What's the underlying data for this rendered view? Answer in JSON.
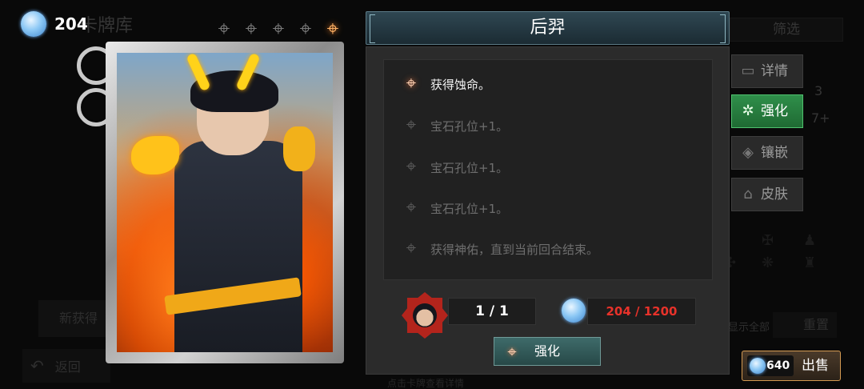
{
  "currency": {
    "gem_count": "204"
  },
  "background": {
    "title": "卡牌库",
    "filter_label": "筛选",
    "new_label": "新获得",
    "back_label": "返回",
    "show_all_label": "显示全部",
    "reset_label": "重置",
    "num_3": "3",
    "num_7": "7+",
    "bottom_hint": "点击卡牌查看详情"
  },
  "stars": {
    "total": 5,
    "active_index": 4
  },
  "card": {
    "name": "后羿"
  },
  "abilities": [
    {
      "text": "获得蚀命。",
      "active": true
    },
    {
      "text": "宝石孔位+1。",
      "active": false
    },
    {
      "text": "宝石孔位+1。",
      "active": false
    },
    {
      "text": "宝石孔位+1。",
      "active": false
    },
    {
      "text": "获得神佑，直到当前回合结束。",
      "active": false
    }
  ],
  "upgrade": {
    "level": "1 / 1",
    "cost": "204 / 1200",
    "cost_color": "#e8322a",
    "button_label": "强化"
  },
  "side_menu": [
    {
      "label": "详情",
      "icon": "card-icon",
      "active": false
    },
    {
      "label": "强化",
      "icon": "sparkle-icon",
      "active": true
    },
    {
      "label": "镶嵌",
      "icon": "gem-socket-icon",
      "active": false
    },
    {
      "label": "皮肤",
      "icon": "hanger-icon",
      "active": false
    }
  ],
  "sell": {
    "price": "640",
    "label": "出售"
  },
  "colors": {
    "accent_green": "#2f8f4a",
    "header_teal": "#2f4752",
    "sell_border": "#d49a52"
  }
}
